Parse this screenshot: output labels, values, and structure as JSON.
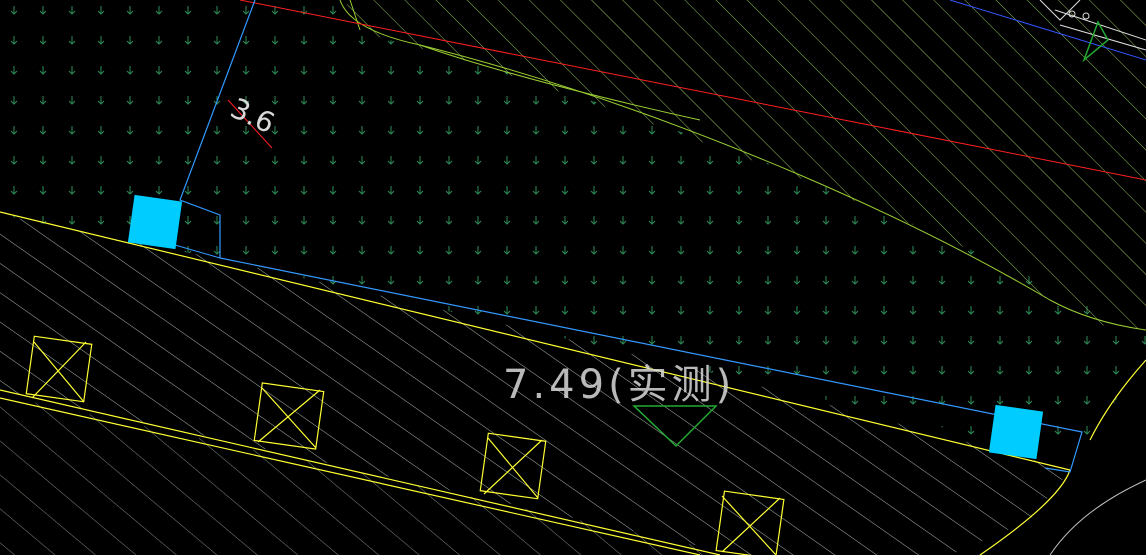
{
  "drawing": {
    "elevation_label": "7.49(实测)",
    "side_label": "3.6"
  },
  "colors": {
    "background": "#000000",
    "lawn_symbol": "#2e8b57",
    "hatch_green": "#9acd32",
    "hatch_gray": "#b8c4b8",
    "road_edge_yellow": "#ffff33",
    "building_outline_blue": "#3399ff",
    "column_fill_cyan": "#00ccff",
    "red_axis": "#ff2020",
    "text_white": "#d9d9d9",
    "elevation_marker_green": "#22aa33"
  },
  "icons": {
    "elevation_marker": "triangle-down-icon",
    "lawn_symbol": "arrow-down-icon",
    "tree_symbol": "box-cross-icon"
  }
}
